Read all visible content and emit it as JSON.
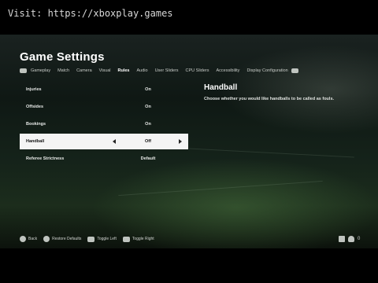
{
  "watermark": "Visit: https://xboxplay.games",
  "title": "Game Settings",
  "tabs": [
    {
      "label": "Gameplay",
      "active": false
    },
    {
      "label": "Match",
      "active": false
    },
    {
      "label": "Camera",
      "active": false
    },
    {
      "label": "Visual",
      "active": false
    },
    {
      "label": "Rules",
      "active": true
    },
    {
      "label": "Audio",
      "active": false
    },
    {
      "label": "User Sliders",
      "active": false
    },
    {
      "label": "CPU Sliders",
      "active": false
    },
    {
      "label": "Accessibility",
      "active": false
    },
    {
      "label": "Display Configuration",
      "active": false
    }
  ],
  "tab_prev_button": "LB",
  "tab_next_button": "RB",
  "settings": [
    {
      "label": "Injuries",
      "value": "On",
      "selected": false
    },
    {
      "label": "Offsides",
      "value": "On",
      "selected": false
    },
    {
      "label": "Bookings",
      "value": "On",
      "selected": false
    },
    {
      "label": "Handball",
      "value": "Off",
      "selected": true
    },
    {
      "label": "Referee Strictness",
      "value": "Default",
      "selected": false
    }
  ],
  "detail": {
    "title": "Handball",
    "description": "Choose whether you would like handballs to be called as fouls."
  },
  "footer": {
    "back": "Back",
    "restore": "Restore Defaults",
    "toggle_left": "Toggle Left",
    "toggle_right": "Toggle Right",
    "count": "0"
  },
  "colors": {
    "selected_row_bg": "#f4f4f4",
    "accent": "#ffffff"
  }
}
